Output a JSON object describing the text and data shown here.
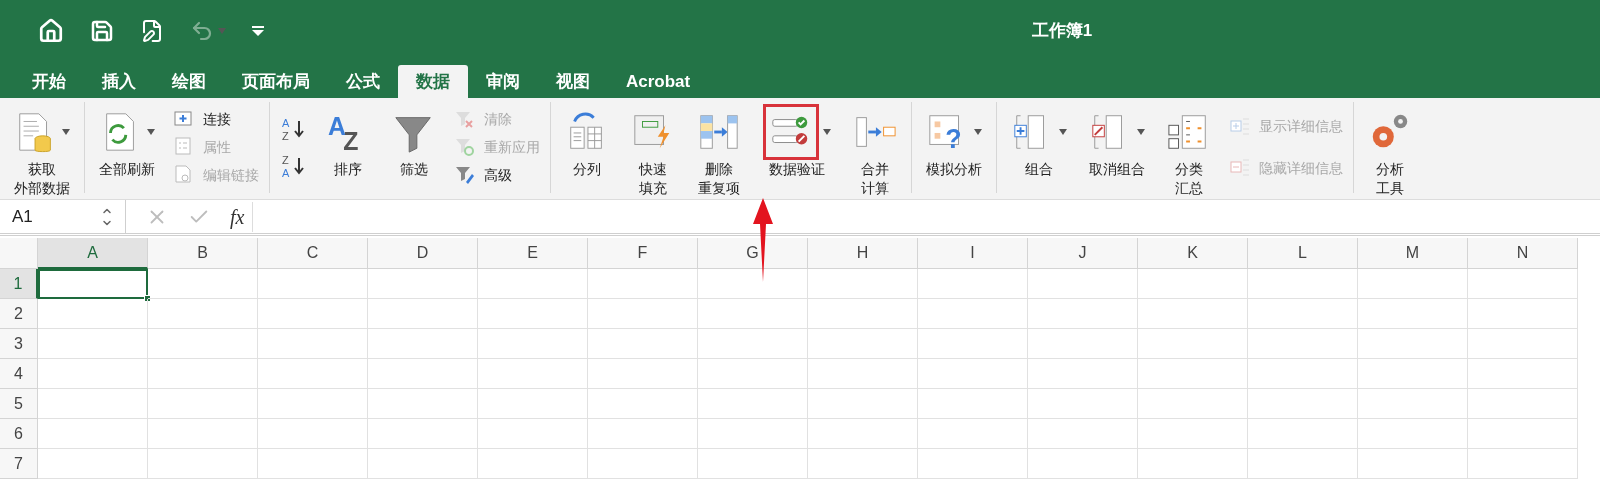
{
  "window": {
    "title": "工作簿1"
  },
  "quick_access": {
    "undo_disabled": true
  },
  "tabs": [
    {
      "label": "开始",
      "selected": false
    },
    {
      "label": "插入",
      "selected": false
    },
    {
      "label": "绘图",
      "selected": false
    },
    {
      "label": "页面布局",
      "selected": false
    },
    {
      "label": "公式",
      "selected": false
    },
    {
      "label": "数据",
      "selected": true
    },
    {
      "label": "审阅",
      "selected": false
    },
    {
      "label": "视图",
      "selected": false
    },
    {
      "label": "Acrobat",
      "selected": false
    }
  ],
  "ribbon": {
    "groups": [
      {
        "items": [
          {
            "kind": "large",
            "lines": [
              "获取",
              "外部数据"
            ],
            "has_menu": true,
            "highlighted": false
          }
        ]
      },
      {
        "items": [
          {
            "kind": "large",
            "lines": [
              "全部刷新"
            ],
            "has_menu": true,
            "highlighted": false
          },
          {
            "kind": "small_stack",
            "items": [
              {
                "label": "连接",
                "disabled": false
              },
              {
                "label": "属性",
                "disabled": true
              },
              {
                "label": "编辑链接",
                "disabled": true
              }
            ]
          }
        ]
      },
      {
        "items": [
          {
            "kind": "sort_pair",
            "ascending": [
              "A",
              "Z"
            ],
            "descending": [
              "Z",
              "A"
            ]
          },
          {
            "kind": "large",
            "lines": [
              "排序"
            ],
            "has_menu": false,
            "highlighted": false,
            "icon_text": [
              "A",
              "Z"
            ]
          },
          {
            "kind": "large",
            "lines": [
              "筛选"
            ],
            "has_menu": false,
            "highlighted": false
          },
          {
            "kind": "small_stack",
            "items": [
              {
                "label": "清除",
                "disabled": true
              },
              {
                "label": "重新应用",
                "disabled": true
              },
              {
                "label": "高级",
                "disabled": false
              }
            ]
          }
        ]
      },
      {
        "items": [
          {
            "kind": "large",
            "lines": [
              "分列"
            ],
            "has_menu": false,
            "highlighted": false
          },
          {
            "kind": "large",
            "lines": [
              "快速",
              "填充"
            ],
            "has_menu": false,
            "highlighted": false
          },
          {
            "kind": "large",
            "lines": [
              "删除",
              "重复项"
            ],
            "has_menu": false,
            "highlighted": false
          },
          {
            "kind": "large",
            "lines": [
              "数据验证"
            ],
            "has_menu": true,
            "highlighted": true
          },
          {
            "kind": "large",
            "lines": [
              "合并",
              "计算"
            ],
            "has_menu": false,
            "highlighted": false
          }
        ]
      },
      {
        "items": [
          {
            "kind": "large",
            "lines": [
              "模拟分析"
            ],
            "has_menu": true,
            "highlighted": false,
            "icon_text": [
              "?"
            ]
          }
        ]
      },
      {
        "items": [
          {
            "kind": "large",
            "lines": [
              "组合"
            ],
            "has_menu": true,
            "highlighted": false
          },
          {
            "kind": "large",
            "lines": [
              "取消组合"
            ],
            "has_menu": true,
            "highlighted": false
          },
          {
            "kind": "large",
            "lines": [
              "分类",
              "汇总"
            ],
            "has_menu": false,
            "highlighted": false
          },
          {
            "kind": "small_stack",
            "items": [
              {
                "label": "显示详细信息",
                "disabled": true
              },
              {
                "label": "隐藏详细信息",
                "disabled": true
              }
            ]
          }
        ]
      },
      {
        "items": [
          {
            "kind": "large",
            "lines": [
              "分析",
              "工具"
            ],
            "has_menu": false,
            "highlighted": false
          }
        ]
      }
    ]
  },
  "formula_bar": {
    "name_box": "A1",
    "function_label": "fx"
  },
  "sheet": {
    "columns": [
      {
        "label": "A",
        "selected": true
      },
      {
        "label": "B",
        "selected": false
      },
      {
        "label": "C",
        "selected": false
      },
      {
        "label": "D",
        "selected": false
      },
      {
        "label": "E",
        "selected": false
      },
      {
        "label": "F",
        "selected": false
      },
      {
        "label": "G",
        "selected": false
      },
      {
        "label": "H",
        "selected": false
      },
      {
        "label": "I",
        "selected": false
      },
      {
        "label": "J",
        "selected": false
      },
      {
        "label": "K",
        "selected": false
      },
      {
        "label": "L",
        "selected": false
      },
      {
        "label": "M",
        "selected": false
      },
      {
        "label": "N",
        "selected": false
      }
    ],
    "rows": [
      {
        "label": "1",
        "selected": true
      },
      {
        "label": "2",
        "selected": false
      },
      {
        "label": "3",
        "selected": false
      },
      {
        "label": "4",
        "selected": false
      },
      {
        "label": "5",
        "selected": false
      },
      {
        "label": "6",
        "selected": false
      },
      {
        "label": "7",
        "selected": false
      }
    ]
  }
}
